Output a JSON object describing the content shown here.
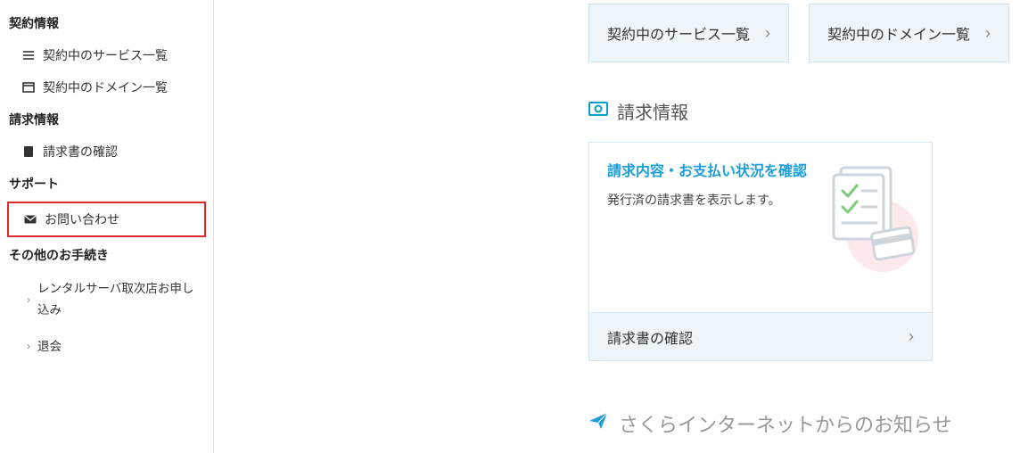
{
  "sidebar": {
    "section_contract": "契約情報",
    "item_services": "契約中のサービス一覧",
    "item_domains": "契約中のドメイン一覧",
    "section_billing": "請求情報",
    "item_invoice": "請求書の確認",
    "section_support": "サポート",
    "item_contact": "お問い合わせ",
    "section_other": "その他のお手続き",
    "item_rental": "レンタルサーバ取次店お申し込み",
    "item_withdraw": "退会"
  },
  "main": {
    "card_services": "契約中のサービス一覧",
    "card_domains": "契約中のドメイン一覧",
    "section_billing": "請求情報",
    "billing_card": {
      "title": "請求内容・お支払い状況を確認",
      "desc": "発行済の請求書を表示します。",
      "footer": "請求書の確認"
    },
    "section_news": "さくらインターネットからのお知らせ"
  }
}
